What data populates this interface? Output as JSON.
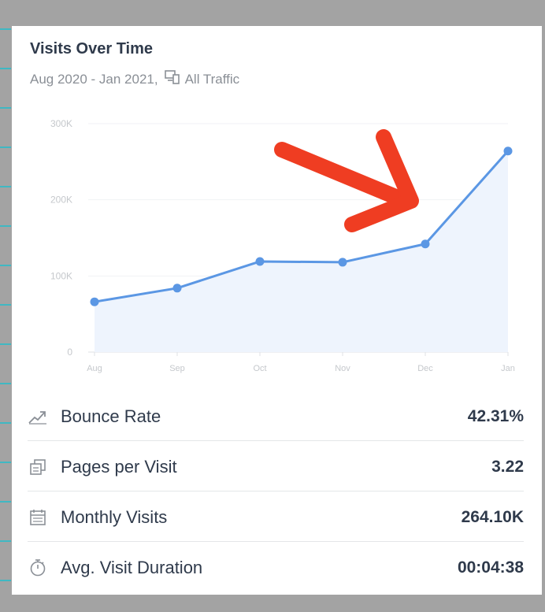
{
  "widget": {
    "title": "Visits Over Time",
    "date_range": "Aug 2020 - Jan 2021,",
    "traffic_label": "All Traffic"
  },
  "chart_data": {
    "type": "area",
    "x": [
      "Aug",
      "Sep",
      "Oct",
      "Nov",
      "Dec",
      "Jan"
    ],
    "series": [
      {
        "values": [
          66000,
          84000,
          119000,
          118000,
          142000,
          264100
        ]
      }
    ],
    "y_ticks": [
      "0",
      "100K",
      "200K",
      "300K"
    ],
    "ylim": [
      0,
      300000
    ],
    "grid": true,
    "line_color": "#5b97e4",
    "fill_color": "#eef4fd",
    "annotation": {
      "kind": "arrow",
      "color": "#ef3d22",
      "points_to": "Dec-Jan rise"
    }
  },
  "metrics": [
    {
      "icon": "trend-up-icon",
      "label": "Bounce Rate",
      "value": "42.31%"
    },
    {
      "icon": "pages-icon",
      "label": "Pages per Visit",
      "value": "3.22"
    },
    {
      "icon": "calendar-icon",
      "label": "Monthly Visits",
      "value": "264.10K"
    },
    {
      "icon": "stopwatch-icon",
      "label": "Avg. Visit Duration",
      "value": "00:04:38"
    }
  ],
  "colors": {
    "frame": "#a3a3a3",
    "card": "#ffffff",
    "text_dark": "#2f3a4b",
    "text_muted": "#8a8f96",
    "accent_teal": "#3fb8c3"
  }
}
